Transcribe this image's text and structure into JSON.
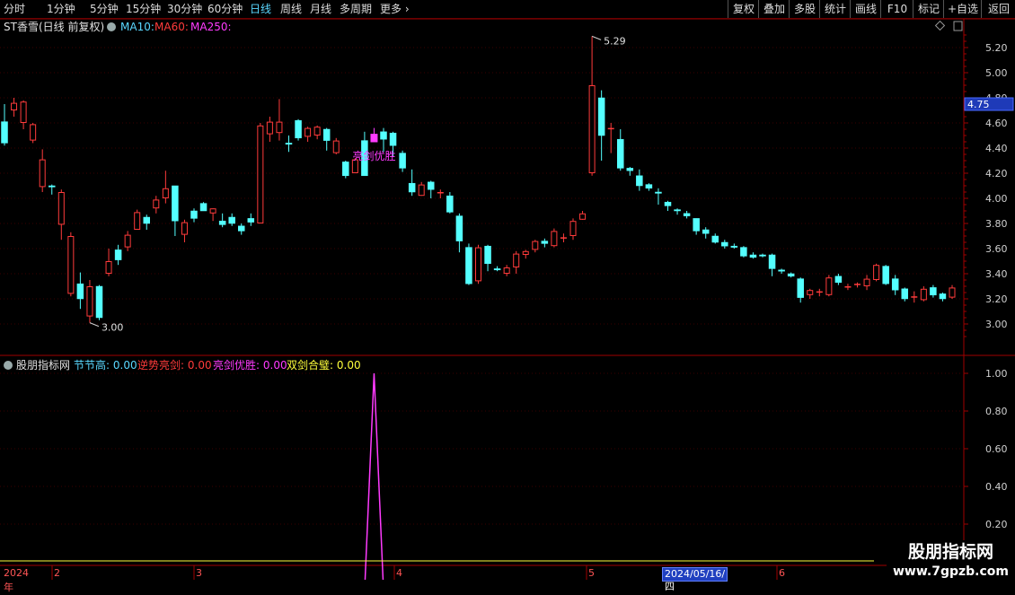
{
  "toolbar": {
    "periods": [
      "分时",
      "1分钟",
      "5分钟",
      "15分钟",
      "30分钟",
      "60分钟",
      "日线",
      "周线",
      "月线",
      "多周期",
      "更多"
    ],
    "active_period": "日线",
    "right_buttons": [
      "复权",
      "叠加",
      "多股",
      "统计",
      "画线",
      "F10",
      "标记",
      "+自选",
      "返回"
    ]
  },
  "main_chart": {
    "stock_name": "ST香雪(日线 前复权)",
    "ma10_label": "MA10:",
    "ma60_label": "MA60:",
    "ma250_label": "MA250:",
    "current_price_tag": "4.75",
    "high_annotation": "5.29",
    "low_annotation": "3.00",
    "signal_text": "亮剑优胜",
    "y_ticks": [
      "5.20",
      "5.00",
      "4.80",
      "4.60",
      "4.40",
      "4.20",
      "4.00",
      "3.80",
      "3.60",
      "3.40",
      "3.20",
      "3.00"
    ]
  },
  "indicator": {
    "name": "股朋指标网",
    "items": [
      {
        "label": "节节高:",
        "value": "0.00",
        "color": "#5ad7ff"
      },
      {
        "label": "逆势亮剑:",
        "value": "0.00",
        "color": "#ff3b3b"
      },
      {
        "label": "亮剑优胜:",
        "value": "0.00",
        "color": "#ff3bff"
      },
      {
        "label": "双剑合璧:",
        "value": "0.00",
        "color": "#ffff3b"
      }
    ],
    "y_ticks": [
      "1.00",
      "0.80",
      "0.60",
      "0.40",
      "0.20"
    ]
  },
  "date_axis": {
    "year_label": "2024年",
    "month_labels": [
      "2",
      "3",
      "4",
      "5",
      "6"
    ],
    "cursor_date": "2024/05/16/四"
  },
  "watermark": {
    "line1": "股朋指标网",
    "line2": "www.7gpzb.com"
  },
  "chart_data": {
    "type": "candlestick",
    "price_range": [
      2.8,
      5.35
    ],
    "candles": [
      [
        4.61,
        4.44,
        4.75,
        4.42
      ],
      [
        4.7,
        4.76,
        4.8,
        4.65
      ],
      [
        4.6,
        4.77,
        4.78,
        4.55
      ],
      [
        4.46,
        4.59,
        4.6,
        4.44
      ],
      [
        4.09,
        4.31,
        4.39,
        4.05
      ],
      [
        4.1,
        4.09,
        4.11,
        4.03
      ],
      [
        3.79,
        4.05,
        4.07,
        3.67
      ],
      [
        3.24,
        3.7,
        3.73,
        3.22
      ],
      [
        3.32,
        3.2,
        3.41,
        3.12
      ],
      [
        3.06,
        3.3,
        3.35,
        3.01
      ],
      [
        3.3,
        3.05,
        3.31,
        3.03
      ],
      [
        3.4,
        3.5,
        3.6,
        3.38
      ],
      [
        3.59,
        3.51,
        3.63,
        3.47
      ],
      [
        3.61,
        3.71,
        3.74,
        3.58
      ],
      [
        3.75,
        3.89,
        3.91,
        3.75
      ],
      [
        3.85,
        3.8,
        3.87,
        3.75
      ],
      [
        3.92,
        3.99,
        4.02,
        3.88
      ],
      [
        4.0,
        4.08,
        4.22,
        3.96
      ],
      [
        4.1,
        3.82,
        4.1,
        3.7
      ],
      [
        3.71,
        3.81,
        3.83,
        3.65
      ],
      [
        3.9,
        3.84,
        3.92,
        3.81
      ],
      [
        3.96,
        3.9,
        3.97,
        3.9
      ],
      [
        3.88,
        3.92,
        3.92,
        3.82
      ],
      [
        3.82,
        3.79,
        3.88,
        3.77
      ],
      [
        3.85,
        3.8,
        3.88,
        3.78
      ],
      [
        3.78,
        3.74,
        3.8,
        3.71
      ],
      [
        3.84,
        3.81,
        3.88,
        3.78
      ],
      [
        3.8,
        4.58,
        4.6,
        3.8
      ],
      [
        4.51,
        4.61,
        4.65,
        4.45
      ],
      [
        4.52,
        4.61,
        4.79,
        4.46
      ],
      [
        4.44,
        4.43,
        4.5,
        4.37
      ],
      [
        4.62,
        4.48,
        4.63,
        4.46
      ],
      [
        4.49,
        4.56,
        4.57,
        4.45
      ],
      [
        4.5,
        4.57,
        4.58,
        4.47
      ],
      [
        4.55,
        4.46,
        4.56,
        4.38
      ],
      [
        4.36,
        4.46,
        4.48,
        4.35
      ],
      [
        4.29,
        4.18,
        4.3,
        4.16
      ],
      [
        4.2,
        4.31,
        4.32,
        4.2
      ],
      [
        4.46,
        4.18,
        4.53,
        4.18
      ],
      [
        4.45,
        4.51,
        4.56,
        4.48
      ],
      [
        4.53,
        4.47,
        4.56,
        4.37
      ],
      [
        4.52,
        4.42,
        4.53,
        4.33
      ],
      [
        4.36,
        4.24,
        4.38,
        4.21
      ],
      [
        4.12,
        4.05,
        4.23,
        4.02
      ],
      [
        4.02,
        4.11,
        4.13,
        4.02
      ],
      [
        4.13,
        4.07,
        4.14,
        4.0
      ],
      [
        4.05,
        4.05,
        4.07,
        4.0
      ],
      [
        4.02,
        3.89,
        4.05,
        3.88
      ],
      [
        3.86,
        3.66,
        3.88,
        3.57
      ],
      [
        3.61,
        3.32,
        3.64,
        3.31
      ],
      [
        3.34,
        3.61,
        3.63,
        3.32
      ],
      [
        3.62,
        3.48,
        3.63,
        3.42
      ],
      [
        3.44,
        3.43,
        3.46,
        3.42
      ],
      [
        3.4,
        3.45,
        3.47,
        3.38
      ],
      [
        3.45,
        3.56,
        3.58,
        3.4
      ],
      [
        3.55,
        3.58,
        3.59,
        3.52
      ],
      [
        3.59,
        3.66,
        3.67,
        3.57
      ],
      [
        3.66,
        3.64,
        3.68,
        3.61
      ],
      [
        3.62,
        3.74,
        3.76,
        3.61
      ],
      [
        3.68,
        3.69,
        3.72,
        3.65
      ],
      [
        3.7,
        3.82,
        3.84,
        3.67
      ],
      [
        3.83,
        3.88,
        3.9,
        3.83
      ],
      [
        4.2,
        4.9,
        5.29,
        4.18
      ],
      [
        4.8,
        4.5,
        4.86,
        4.3
      ],
      [
        4.56,
        4.56,
        4.6,
        4.36
      ],
      [
        4.47,
        4.24,
        4.55,
        4.22
      ],
      [
        4.24,
        4.22,
        4.25,
        4.18
      ],
      [
        4.18,
        4.1,
        4.23,
        4.06
      ],
      [
        4.11,
        4.08,
        4.12,
        4.06
      ],
      [
        4.05,
        4.04,
        4.08,
        3.95
      ],
      [
        3.97,
        3.94,
        3.98,
        3.9
      ],
      [
        3.91,
        3.9,
        3.92,
        3.87
      ],
      [
        3.88,
        3.86,
        3.9,
        3.84
      ],
      [
        3.84,
        3.74,
        3.84,
        3.71
      ],
      [
        3.75,
        3.72,
        3.77,
        3.68
      ],
      [
        3.7,
        3.65,
        3.72,
        3.64
      ],
      [
        3.65,
        3.62,
        3.67,
        3.6
      ],
      [
        3.62,
        3.61,
        3.64,
        3.6
      ],
      [
        3.61,
        3.54,
        3.62,
        3.53
      ],
      [
        3.55,
        3.53,
        3.57,
        3.52
      ],
      [
        3.55,
        3.54,
        3.56,
        3.53
      ],
      [
        3.55,
        3.44,
        3.56,
        3.38
      ],
      [
        3.43,
        3.42,
        3.44,
        3.4
      ],
      [
        3.4,
        3.38,
        3.41,
        3.37
      ],
      [
        3.36,
        3.21,
        3.37,
        3.17
      ],
      [
        3.23,
        3.27,
        3.28,
        3.2
      ],
      [
        3.25,
        3.26,
        3.28,
        3.22
      ],
      [
        3.23,
        3.37,
        3.39,
        3.22
      ],
      [
        3.38,
        3.33,
        3.4,
        3.31
      ],
      [
        3.3,
        3.3,
        3.32,
        3.27
      ],
      [
        3.31,
        3.32,
        3.33,
        3.29
      ],
      [
        3.3,
        3.36,
        3.39,
        3.27
      ],
      [
        3.35,
        3.47,
        3.48,
        3.34
      ],
      [
        3.46,
        3.32,
        3.47,
        3.31
      ],
      [
        3.36,
        3.27,
        3.39,
        3.23
      ],
      [
        3.28,
        3.2,
        3.29,
        3.18
      ],
      [
        3.22,
        3.22,
        3.26,
        3.17
      ],
      [
        3.19,
        3.28,
        3.3,
        3.18
      ],
      [
        3.29,
        3.23,
        3.31,
        3.21
      ],
      [
        3.24,
        3.2,
        3.25,
        3.18
      ],
      [
        3.21,
        3.29,
        3.31,
        3.2
      ]
    ],
    "signal_index": 39,
    "signal_candle_color": "#ff3bff",
    "indicator_series": {
      "name": "亮剑优胜",
      "peak_index": 39,
      "peak_value": 1.0,
      "ylim": [
        0,
        1.1
      ]
    },
    "colors": {
      "up": "#ff3b3b",
      "down": "#54ffff",
      "signal": "#ff3bff",
      "grid": "#3a0000",
      "axis": "#a00000"
    }
  }
}
